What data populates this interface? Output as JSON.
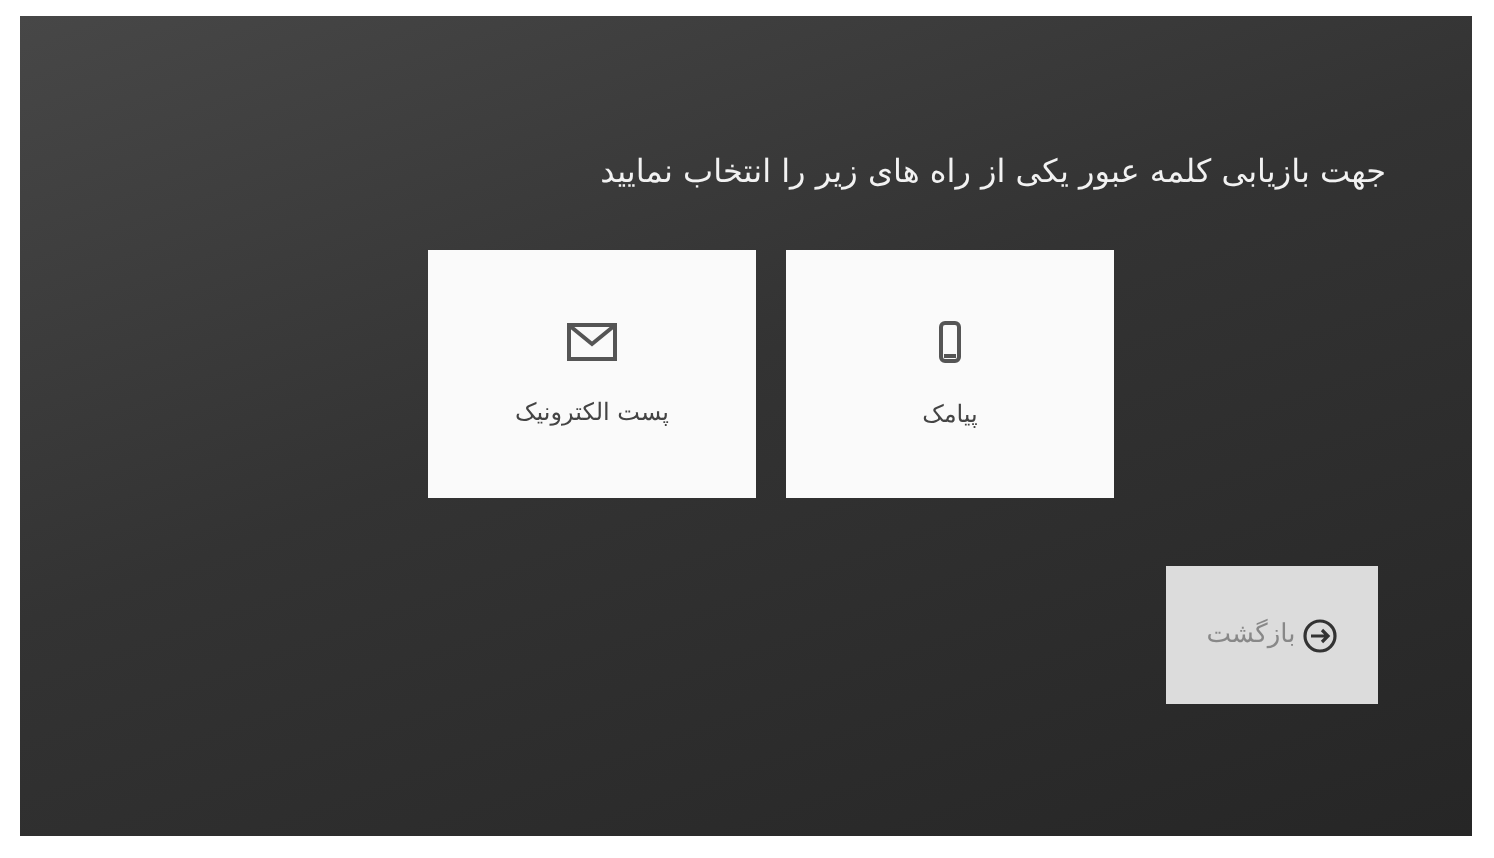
{
  "title": "جهت بازیابی کلمه عبور یکی از راه های زیر را انتخاب نمایید",
  "options": [
    {
      "kind": "sms",
      "label": "پیامک"
    },
    {
      "kind": "email",
      "label": "پست الکترونیک"
    }
  ],
  "back_button": {
    "label": "بازگشت"
  }
}
